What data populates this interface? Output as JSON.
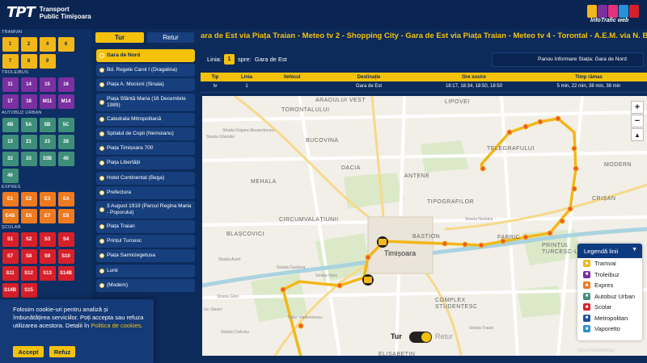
{
  "header": {
    "logo_mark": "TPT",
    "logo_line1": "Transport",
    "logo_line2": "Public Timișoara",
    "infotrafic": "InfoTrafic web"
  },
  "ticker": "ara de Est via Piața Traian - Meteo tv 2 - Shopping City - Gara de Est via Piața Traian - Meteo tv 4 - Torontal - A.E.M. via N. Bălcescu tv",
  "sections": [
    {
      "label": "TRAMVAI",
      "color": "#f2b718",
      "text": "#0a2552",
      "lines": [
        "1",
        "2",
        "4",
        "6",
        "7",
        "8",
        "9"
      ]
    },
    {
      "label": "TROLEIBUS",
      "color": "#7b2fa0",
      "text": "#ffffff",
      "lines": [
        "11",
        "14",
        "15",
        "16",
        "17",
        "18",
        "M11",
        "M14"
      ]
    },
    {
      "label": "AUTOBUZ URBAN",
      "color": "#3e8f7a",
      "text": "#ffffff",
      "lines": [
        "4B",
        "5A",
        "5B",
        "5C",
        "13",
        "21",
        "23",
        "28",
        "32",
        "33",
        "33B",
        "40",
        "46"
      ]
    },
    {
      "label": "EXPRES",
      "color": "#f07a1e",
      "text": "#ffffff",
      "lines": [
        "E1",
        "E2",
        "E3",
        "E4",
        "E4B",
        "E6",
        "E7",
        "E8"
      ]
    },
    {
      "label": "ȘCOLAR",
      "color": "#d8202a",
      "text": "#ffffff",
      "lines": [
        "S1",
        "S2",
        "S3",
        "S4",
        "S7",
        "S8",
        "S9",
        "S10",
        "S11",
        "S12",
        "S13",
        "S14B",
        "S14B",
        "S15"
      ]
    }
  ],
  "directions": {
    "tur": "Tur",
    "retur": "Retur"
  },
  "stops": [
    "Gara de Nord",
    "Bd. Regele Carol I (Dragalina)",
    "Piața A. Mocioni (Sinaia)",
    "Piața Sfântă Maria (16 Decembrie 1989)",
    "Catedrala Mitropolitană",
    "Spitalul de Copii (Nemoianu)",
    "Piața Timișoara 700",
    "Piața Libertății",
    "Hotel Continental (Bega)",
    "Prefectura",
    "3 August 1919 (Parcul Regina Maria - Poporului)",
    "Piața Traian",
    "Prințul Turcesc",
    "Piața Sarmizegetusa",
    "Lunii",
    "(Modem)"
  ],
  "info": {
    "line_label": "Linia:",
    "line_number": "1",
    "to_label": "spre:",
    "destination": "Gara de Est",
    "panou": "Panou Informare Stația: Gara de Nord"
  },
  "table": {
    "headers": [
      "Tip",
      "Linia",
      "Vehicul",
      "Destinație",
      "Ore sosire",
      "Timp rămas"
    ],
    "rows": [
      [
        "tv",
        "1",
        "",
        "Gara de Est",
        "18:17, 18:34, 18:50, 18:50",
        "5 min, 22 min, 38 min, 38 min"
      ]
    ]
  },
  "map": {
    "labels": [
      "ARADULUI VEST",
      "LIPOVEI",
      "TORONTALULUI",
      "TELEGRAFULUI",
      "BUCOVINA",
      "DACIA",
      "MODERN",
      "ANTENE",
      "MEHALA",
      "TIPOGRAFILOR",
      "CRIȘAN",
      "CIRCUMVALAȚIUNII",
      "BASTION",
      "BLAȘCOVICI",
      "FABRIC",
      "PRINȚUL TURCESC-LUNEI",
      "Timișoara",
      "ELISABETIN",
      "COMPLEX STUDENȚESC",
      "Strada Dunărea",
      "Strada Nera",
      "Tudor Vladimirescu",
      "Strada Gării",
      "Strada Corbului",
      "Ion Slavici",
      "Strada Aurel",
      "Strada Ghirodei",
      "Strada Grigore Alexandrescu",
      "Strada Traian",
      "Strada Nestalul"
    ],
    "zoom_in": "+",
    "zoom_out": "−",
    "toggle_tur": "Tur",
    "toggle_retur": "Retur",
    "attribution": "OpenStreetMap"
  },
  "legend": {
    "title": "Legendă linii",
    "items": [
      {
        "label": "Tramvai",
        "color": "#f2b718"
      },
      {
        "label": "Troleibuz",
        "color": "#7b2fa0"
      },
      {
        "label": "Expres",
        "color": "#f07a1e"
      },
      {
        "label": "Autobuz Urban",
        "color": "#3e8f7a"
      },
      {
        "label": "Școlar",
        "color": "#d8202a"
      },
      {
        "label": "Metropolitan",
        "color": "#1e4fa3"
      },
      {
        "label": "Vaporetto",
        "color": "#2a8fd8"
      }
    ]
  },
  "cookie": {
    "text": "Folosim cookie-uri pentru analiză și îmbunătățirea serviciilor. Poți accepta sau refuza utilizarea acestora. Detalii în",
    "link": "Politica de cookies",
    "accept": "Accept",
    "refuse": "Refuz"
  }
}
